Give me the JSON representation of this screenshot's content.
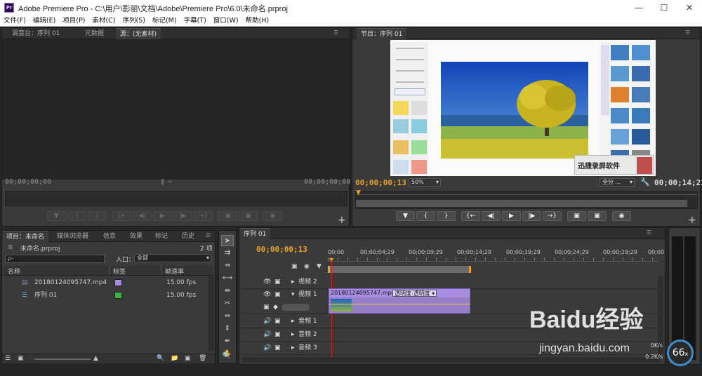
{
  "window": {
    "title": "Adobe Premiere Pro - C:\\用户\\影丽\\文档\\Adobe\\Premiere Pro\\6.0\\未命名.prproj",
    "logo": "Pr"
  },
  "menu": [
    "文件(F)",
    "编辑(E)",
    "项目(P)",
    "素材(C)",
    "序列(S)",
    "标记(M)",
    "字幕(T)",
    "窗口(W)",
    "帮助(H)"
  ],
  "source_panel": {
    "tabs": [
      "调音台：序列 01",
      "元数据",
      "源：(无素材)"
    ],
    "tc_left": "00;00;00;00",
    "tc_right": "00;00;00;00"
  },
  "program_panel": {
    "tab": "节目：序列 01",
    "tc_current": "00;00;00;13",
    "zoom": "50%",
    "quality": "全分 ...",
    "tc_duration": "00;00;14;21",
    "watermark_text": "迅捷录屏软件"
  },
  "project_panel": {
    "tabs": [
      "项目：未命名",
      "媒体浏览器",
      "信息",
      "效果",
      "标记",
      "历史"
    ],
    "project_name": "未命名.prproj",
    "item_count": "2 项",
    "search_placeholder": "ρ-",
    "entry_label": "入口：",
    "entry_value": "全部",
    "columns": [
      "名称",
      "标签",
      "帧速率"
    ],
    "items": [
      {
        "name": "20180124095747.mp4",
        "label_color": "#a78ce0",
        "fps": "15.00 fps"
      },
      {
        "name": "序列 01",
        "label_color": "#3cb043",
        "fps": "15.00 fps"
      }
    ]
  },
  "timeline": {
    "tab": "序列 01",
    "tc": "00;00;00;13",
    "ruler": [
      "00;00",
      "00;00;04;29",
      "00;00;09;29",
      "00;00;14;29",
      "00;00;19;29",
      "00;00;24;29",
      "00;00;29;29",
      "00;00"
    ],
    "tracks": {
      "v2": "视频 2",
      "v1": "视频 1",
      "a1": "音频 1",
      "a2": "音频 2",
      "a3": "音频 3"
    },
    "clip_name": "20180124095747.mp4",
    "clip_effect": "透明度:透明度",
    "clip_color": "#a78ce0"
  },
  "meter": {
    "value": "66",
    "unit": "x",
    "net_up": "0K/s",
    "net_down": "0.2K/s"
  },
  "watermark": {
    "brand": "Baidu经验",
    "url": "jingyan.baidu.com"
  },
  "icons": [
    "marker-icon",
    "step-back-icon",
    "play-icon",
    "step-forward-icon",
    "camera-icon",
    "selection-tool-icon",
    "hand-tool-icon",
    "zoom-tool-icon",
    "eye-icon",
    "speaker-icon"
  ]
}
